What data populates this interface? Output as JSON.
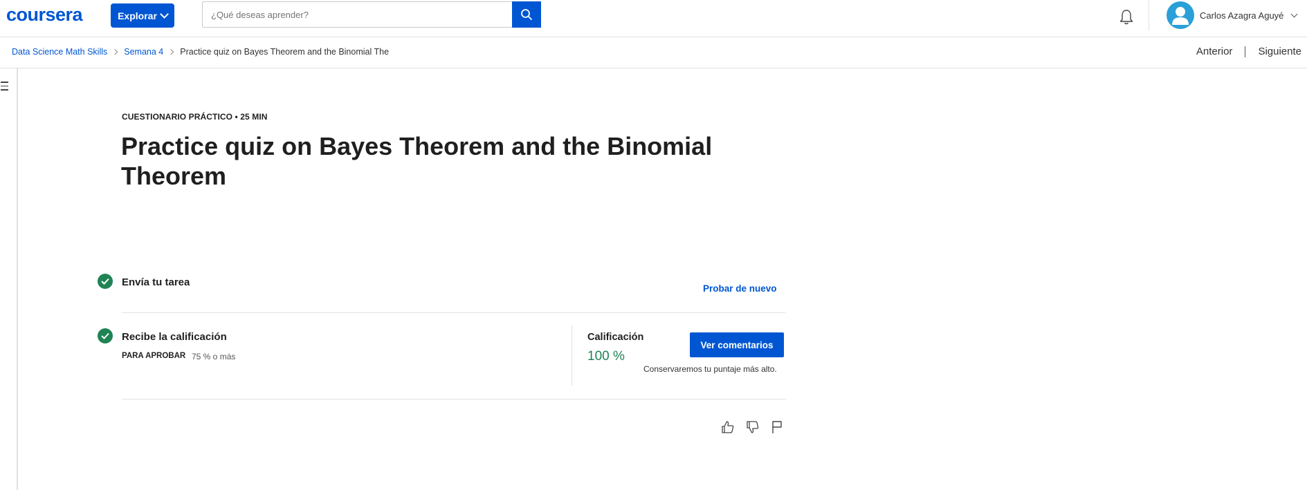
{
  "header": {
    "logo": "coursera",
    "explore_label": "Explorar",
    "search_placeholder": "¿Qué deseas aprender?",
    "user_name": "Carlos Azagra Aguyé"
  },
  "breadcrumb": {
    "items": [
      "Data Science Math Skills",
      "Semana 4"
    ],
    "current": "Practice quiz on Bayes Theorem and the Binomial The"
  },
  "nav": {
    "prev": "Anterior",
    "next": "Siguiente"
  },
  "quiz": {
    "eyebrow": "CUESTIONARIO PRÁCTICO • 25 MIN",
    "title": "Practice quiz on Bayes Theorem and the Binomial Theorem"
  },
  "steps": {
    "submit_label": "Envía tu tarea",
    "retry_label": "Probar de nuevo",
    "grade_step_label": "Recibe la calificación",
    "pass_label": "PARA APROBAR",
    "pass_value": "75 % o más",
    "grade_label": "Calificación",
    "grade_value": "100 %",
    "feedback_button": "Ver comentarios",
    "keep_note": "Conservaremos tu puntaje más alto."
  },
  "colors": {
    "brand": "#0056d2",
    "success": "#1f8354",
    "avatar": "#2a9fd8"
  },
  "icons": [
    "search-icon",
    "bell-icon",
    "avatar-icon",
    "menu-icon",
    "check-icon",
    "thumbs-up-icon",
    "thumbs-down-icon",
    "flag-icon"
  ]
}
